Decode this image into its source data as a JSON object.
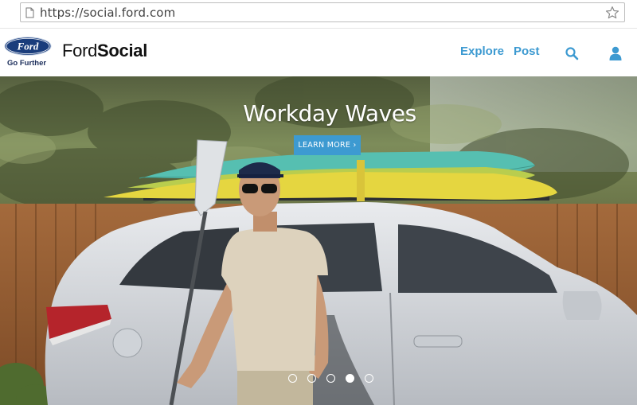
{
  "browser": {
    "url": "https://social.ford.com"
  },
  "header": {
    "logo_text": "Ford",
    "tagline": "Go Further",
    "brand_part1": "Ford",
    "brand_part2": "Social",
    "nav": [
      {
        "label": "Explore"
      },
      {
        "label": "Post"
      }
    ],
    "icons": [
      "search-icon",
      "user-icon"
    ]
  },
  "hero": {
    "title": "Workday Waves",
    "cta_label": "LEARN MORE ›",
    "carousel_slide_count": 5,
    "carousel_active_index": 3
  },
  "colors": {
    "accent": "#3d9ad1",
    "ford_blue": "#1a3d7c"
  }
}
